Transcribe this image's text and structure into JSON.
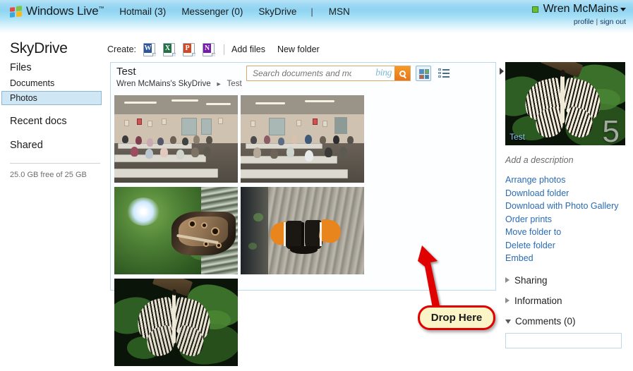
{
  "header": {
    "brand": "Windows Live",
    "brand_tm": "™",
    "nav": [
      {
        "label": "Hotmail (3)",
        "name": "nav-hotmail"
      },
      {
        "label": "Messenger (0)",
        "name": "nav-messenger"
      },
      {
        "label": "SkyDrive",
        "name": "nav-skydrive"
      },
      {
        "label": "MSN",
        "name": "nav-msn"
      }
    ],
    "separator": "|",
    "user_name": "Wren McMains",
    "profile_label": "profile",
    "signout_label": "sign out",
    "link_sep": "|"
  },
  "sidebar": {
    "title": "SkyDrive",
    "items": [
      {
        "label": "Files",
        "name": "sidebar-item-files",
        "level": "top",
        "selected": false
      },
      {
        "label": "Documents",
        "name": "sidebar-item-documents",
        "level": "sub",
        "selected": false
      },
      {
        "label": "Photos",
        "name": "sidebar-item-photos",
        "level": "sub",
        "selected": true
      },
      {
        "label": "Recent docs",
        "name": "sidebar-item-recent-docs",
        "level": "top",
        "selected": false
      },
      {
        "label": "Shared",
        "name": "sidebar-item-shared",
        "level": "top",
        "selected": false
      }
    ],
    "quota": "25.0 GB free of 25 GB"
  },
  "toolbar": {
    "create_label": "Create:",
    "create_icons": [
      {
        "letter": "W",
        "name": "create-word-document-icon",
        "kind": "word"
      },
      {
        "letter": "X",
        "name": "create-excel-workbook-icon",
        "kind": "excel"
      },
      {
        "letter": "P",
        "name": "create-powerpoint-presentation-icon",
        "kind": "ppt"
      },
      {
        "letter": "N",
        "name": "create-onenote-notebook-icon",
        "kind": "note"
      }
    ],
    "add_files_label": "Add files",
    "new_folder_label": "New folder"
  },
  "main": {
    "folder_title": "Test",
    "breadcrumb_root": "Wren McMains's SkyDrive",
    "breadcrumb_arrow": "►",
    "breadcrumb_current": "Test",
    "search_placeholder": "Search documents and more",
    "search_value": "",
    "bing_label": "bing",
    "photos": [
      {
        "name": "photo-thumbnail-classroom-1",
        "alt": "classroom-meeting-room-1"
      },
      {
        "name": "photo-thumbnail-classroom-2",
        "alt": "classroom-meeting-room-2"
      },
      {
        "name": "photo-thumbnail-butterfly-owl",
        "alt": "owl-butterfly-on-green-leaf"
      },
      {
        "name": "photo-thumbnail-butterfly-orange",
        "alt": "orange-black-butterfly-on-wood"
      },
      {
        "name": "photo-thumbnail-butterfly-paperkite",
        "alt": "paper-kite-butterfly-on-leaf"
      }
    ]
  },
  "right_panel": {
    "thumb_label": "Test",
    "thumb_count": "5",
    "add_description": "Add a description",
    "action_links": [
      {
        "label": "Arrange photos",
        "name": "link-arrange-photos"
      },
      {
        "label": "Download folder",
        "name": "link-download-folder"
      },
      {
        "label": "Download with Photo Gallery",
        "name": "link-download-with-photo-gallery"
      },
      {
        "label": "Order prints",
        "name": "link-order-prints"
      },
      {
        "label": "Move folder to",
        "name": "link-move-folder-to"
      },
      {
        "label": "Delete folder",
        "name": "link-delete-folder"
      },
      {
        "label": "Embed",
        "name": "link-embed"
      }
    ],
    "sections": [
      {
        "label": "Sharing",
        "name": "section-sharing",
        "expanded": false
      },
      {
        "label": "Information",
        "name": "section-information",
        "expanded": false
      },
      {
        "label": "Comments (0)",
        "name": "section-comments",
        "expanded": true
      }
    ],
    "comment_value": ""
  },
  "annotation": {
    "callout_text": "Drop Here",
    "callout_fill": "#fbf4c6",
    "callout_border": "#e00000",
    "arrow_color": "#e00000"
  },
  "colors": {
    "header_blue": "#8fd4f2",
    "link_blue": "#2a6bb5",
    "selected_bg": "#cfe7f5",
    "panel_border": "#bcd9ec",
    "search_border": "#d9a86a"
  }
}
